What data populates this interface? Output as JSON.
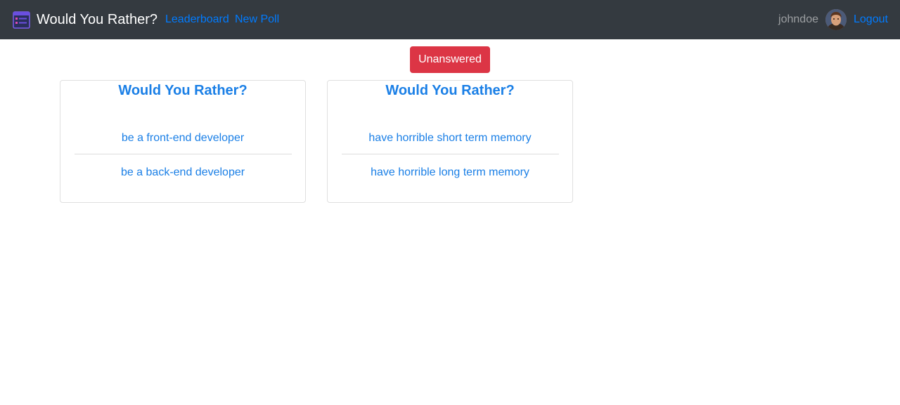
{
  "navbar": {
    "brand_title": "Would You Rather?",
    "links": [
      "Leaderboard",
      "New Poll"
    ],
    "username": "johndoe",
    "logout_label": "Logout",
    "colors": {
      "background": "#343a40",
      "link": "#007bff"
    }
  },
  "filter_button": {
    "label": "Unanswered",
    "color": "#dc3545"
  },
  "questions": [
    {
      "title": "Would You Rather?",
      "option_one": "be a front-end developer",
      "option_two": "be a back-end developer"
    },
    {
      "title": "Would You Rather?",
      "option_one": "have horrible short term memory",
      "option_two": "have horrible long term memory"
    }
  ]
}
